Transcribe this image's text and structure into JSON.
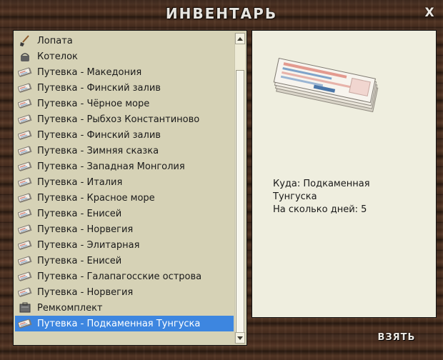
{
  "window": {
    "title": "ИНВЕНТАРЬ",
    "close_label": "X"
  },
  "inventory": {
    "items": [
      {
        "label": "Лопата",
        "icon": "shovel-icon"
      },
      {
        "label": "Котелок",
        "icon": "pot-icon"
      },
      {
        "label": "Путевка - Македония",
        "icon": "ticket-icon"
      },
      {
        "label": "Путевка - Финский залив",
        "icon": "ticket-icon"
      },
      {
        "label": "Путевка - Чёрное море",
        "icon": "ticket-icon"
      },
      {
        "label": "Путевка - Рыбхоз Константиново",
        "icon": "ticket-icon"
      },
      {
        "label": "Путевка - Финский залив",
        "icon": "ticket-icon"
      },
      {
        "label": "Путевка - Зимняя сказка",
        "icon": "ticket-icon"
      },
      {
        "label": "Путевка - Западная Монголия",
        "icon": "ticket-icon"
      },
      {
        "label": "Путевка - Италия",
        "icon": "ticket-icon"
      },
      {
        "label": "Путевка - Красное море",
        "icon": "ticket-icon"
      },
      {
        "label": "Путевка - Енисей",
        "icon": "ticket-icon"
      },
      {
        "label": "Путевка - Норвегия",
        "icon": "ticket-icon"
      },
      {
        "label": "Путевка - Элитарная",
        "icon": "ticket-icon"
      },
      {
        "label": "Путевка - Енисей",
        "icon": "ticket-icon"
      },
      {
        "label": "Путевка - Галапагосские острова",
        "icon": "ticket-icon"
      },
      {
        "label": "Путевка - Норвегия",
        "icon": "ticket-icon"
      },
      {
        "label": "Ремкомплект",
        "icon": "repair-kit-icon"
      },
      {
        "label": "Путевка - Подкаменная Тунгуска",
        "icon": "ticket-icon",
        "selected": true
      }
    ]
  },
  "detail": {
    "line1": "Куда: Подкаменная",
    "line2": "Тунгуска",
    "line3": "На сколько дней: 5"
  },
  "actions": {
    "take_label": "ВЗЯТЬ"
  },
  "colors": {
    "selection": "#3d86e0",
    "list_bg": "#d6d2b6",
    "detail_bg": "#efeedf"
  }
}
